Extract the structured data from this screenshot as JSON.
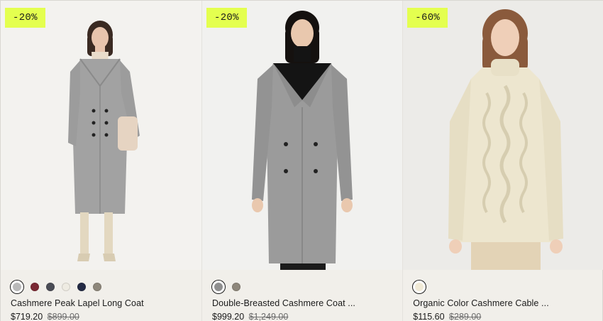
{
  "products": [
    {
      "badge": "-20%",
      "name": "Cashmere Peak Lapel Long Coat",
      "price": "$719.20",
      "original_price": "$899.00",
      "background": "#f3f2ef",
      "swatches": [
        {
          "color": "#b9b9b9",
          "selected": true
        },
        {
          "color": "#7a2833",
          "selected": false
        },
        {
          "color": "#4a4c55",
          "selected": false
        },
        {
          "color": "#eeebe2",
          "selected": false
        },
        {
          "color": "#232a44",
          "selected": false
        },
        {
          "color": "#8e877b",
          "selected": false
        }
      ]
    },
    {
      "badge": "-20%",
      "name": "Double-Breasted Cashmere Coat ...",
      "price": "$999.20",
      "original_price": "$1,249.00",
      "background": "#f1f1ef",
      "swatches": [
        {
          "color": "#8f8f8f",
          "selected": true
        },
        {
          "color": "#8e877b",
          "selected": false
        }
      ]
    },
    {
      "badge": "-60%",
      "name": "Organic Color Cashmere Cable ...",
      "price": "$115.60",
      "original_price": "$289.00",
      "background": "#ecebe8",
      "swatches": [
        {
          "color": "#f1ead6",
          "selected": true
        }
      ]
    }
  ],
  "colors": {
    "badge": "#e4ff4f",
    "coat_grey": "#9e9e9e",
    "sweater_cream": "#ede6cf"
  }
}
